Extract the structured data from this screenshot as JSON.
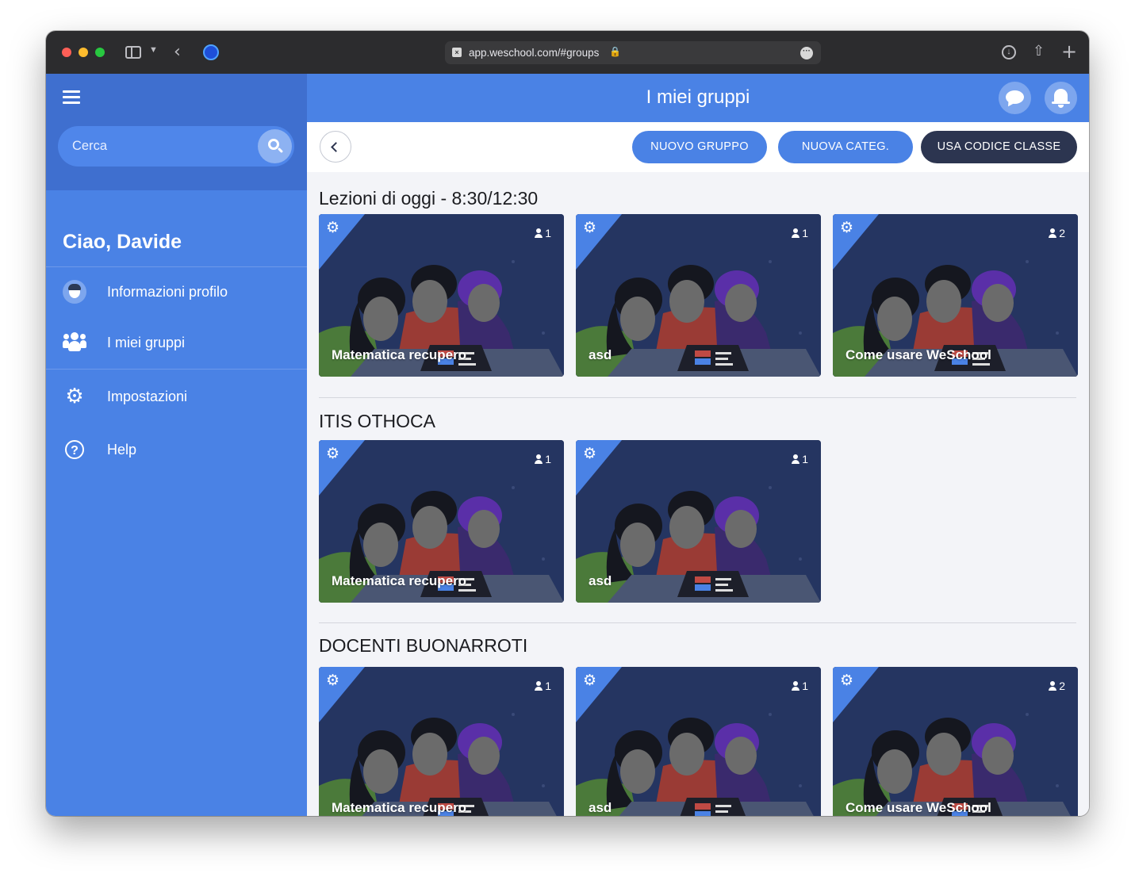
{
  "browser": {
    "url": "app.weschool.com/#groups"
  },
  "sidebar": {
    "search_placeholder": "Cerca",
    "greeting": "Ciao, Davide",
    "items": [
      {
        "label": "Informazioni profilo",
        "icon": "profile-avatar-icon"
      },
      {
        "label": "I miei gruppi",
        "icon": "users-group-icon"
      },
      {
        "label": "Impostazioni",
        "icon": "gear-icon"
      },
      {
        "label": "Help",
        "icon": "question-circle-icon"
      }
    ]
  },
  "header": {
    "title": "I miei gruppi"
  },
  "toolbar": {
    "new_group": "NUOVO GRUPPO",
    "new_category": "NUOVA CATEG.",
    "use_class_code": "USA CODICE CLASSE"
  },
  "sections": [
    {
      "title": "Lezioni di oggi - 8:30/12:30",
      "groups": [
        {
          "name": "Matematica recupero",
          "members": "1"
        },
        {
          "name": "asd",
          "members": "1"
        },
        {
          "name": "Come usare WeSchool",
          "members": "2"
        }
      ]
    },
    {
      "title": "ITIS OTHOCA",
      "groups": [
        {
          "name": "Matematica recupero",
          "members": "1"
        },
        {
          "name": "asd",
          "members": "1"
        }
      ]
    },
    {
      "title": "DOCENTI BUONARROTI",
      "groups": [
        {
          "name": "Matematica recupero",
          "members": "1"
        },
        {
          "name": "asd",
          "members": "1"
        },
        {
          "name": "Come usare WeSchool",
          "members": "2"
        }
      ]
    }
  ],
  "colors": {
    "primary": "#4a82e5",
    "sidebar_top": "#3f6fcf",
    "dark_button": "#2c3550",
    "card_background": "#253561"
  }
}
